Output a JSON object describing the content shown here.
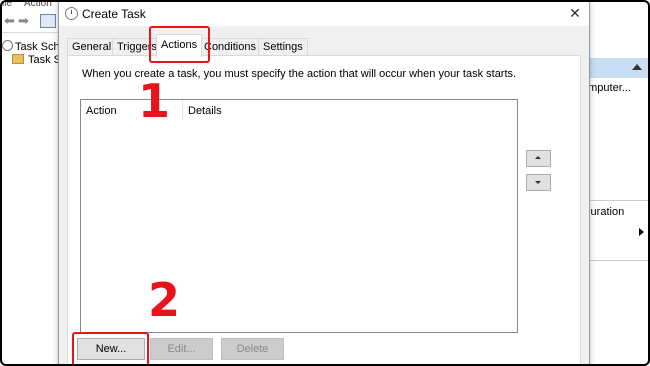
{
  "background_app": {
    "menu": [
      "ile",
      "Action"
    ],
    "tree_items": [
      "Task Sche",
      "Task S"
    ],
    "right_pane": {
      "texts": [
        "omputer...",
        "s",
        "iguration"
      ]
    }
  },
  "dialog": {
    "title": "Create Task",
    "close_glyph": "✕",
    "tabs": [
      {
        "label": "General"
      },
      {
        "label": "Triggers"
      },
      {
        "label": "Actions",
        "active": true
      },
      {
        "label": "Conditions"
      },
      {
        "label": "Settings"
      }
    ],
    "instruction": "When you create a task, you must specify the action that will occur when your task starts.",
    "table": {
      "columns": [
        "Action",
        "Details"
      ],
      "rows": []
    },
    "buttons": {
      "new": "New...",
      "edit": "Edit...",
      "delete": "Delete"
    }
  },
  "annotations": {
    "step1": "1",
    "step2": "2",
    "highlight_color": "#e8141c"
  }
}
